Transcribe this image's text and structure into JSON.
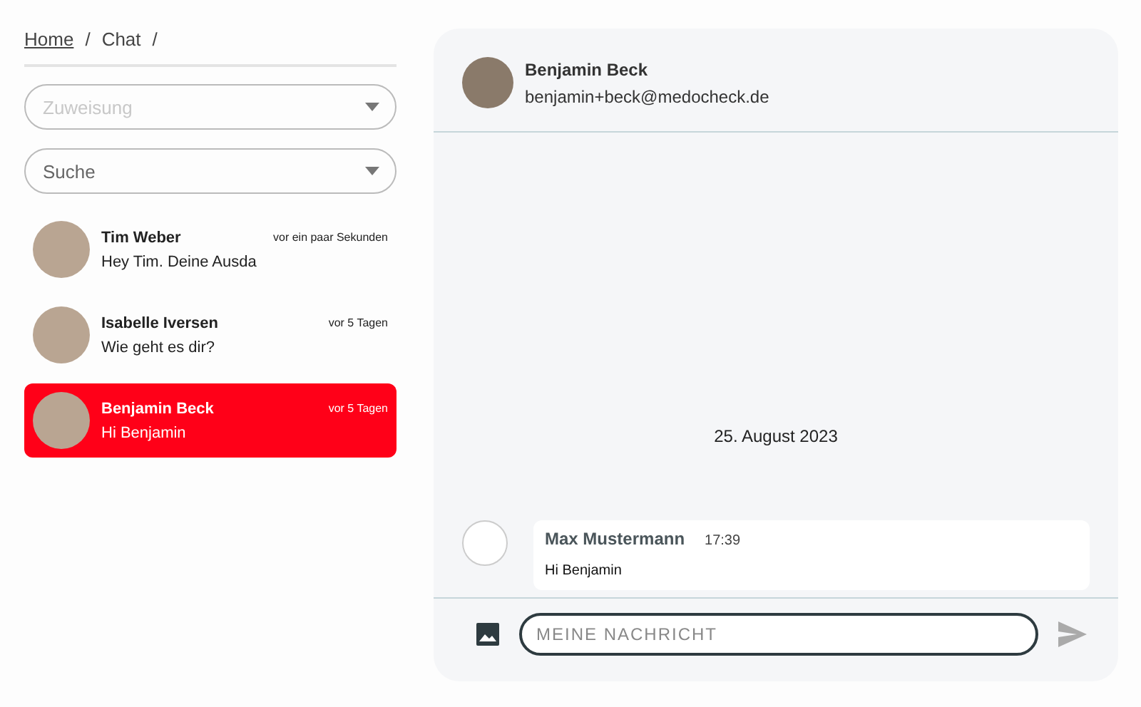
{
  "breadcrumb": [
    {
      "label": "Home",
      "link": true,
      "separator": "/"
    },
    {
      "label": "Chat",
      "link": false,
      "separator": "/"
    }
  ],
  "filters": [
    {
      "placeholder": "Zuweisung",
      "disabled": true
    },
    {
      "placeholder": "Suche",
      "disabled": false
    }
  ],
  "conversations": [
    {
      "name": "Tim Weber",
      "preview": "Hey Tim. Deine Ausda",
      "time": "vor ein paar Sekunden",
      "selected": false
    },
    {
      "name": "Isabelle Iversen",
      "preview": "Wie geht es dir?",
      "time": "vor 5 Tagen",
      "selected": false
    },
    {
      "name": "Benjamin Beck",
      "preview": "Hi Benjamin",
      "time": "vor 5 Tagen",
      "selected": true
    }
  ],
  "chat": {
    "name": "Benjamin Beck",
    "email": "benjamin+beck@medocheck.de",
    "date": "25. August 2023",
    "messages": [
      {
        "sender": "Max Mustermann",
        "time": "17:39",
        "text": "Hi Benjamin"
      }
    ],
    "composer": {
      "placeholder": "MEINE NACHRICHT"
    }
  }
}
